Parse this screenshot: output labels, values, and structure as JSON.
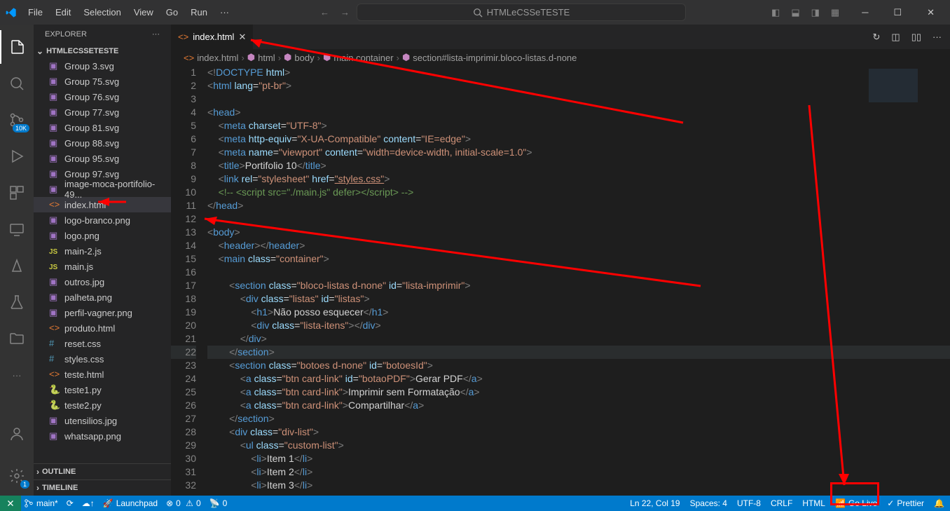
{
  "menu": {
    "file": "File",
    "edit": "Edit",
    "selection": "Selection",
    "view": "View",
    "go": "Go",
    "run": "Run"
  },
  "searchPlaceholder": "HTMLeCSSeTESTE",
  "explorer": {
    "title": "EXPLORER",
    "project": "HTMLECSSETESTE"
  },
  "files": [
    {
      "name": "Group 3.svg",
      "icon": "svg"
    },
    {
      "name": "Group 75.svg",
      "icon": "svg"
    },
    {
      "name": "Group 76.svg",
      "icon": "svg"
    },
    {
      "name": "Group 77.svg",
      "icon": "svg"
    },
    {
      "name": "Group 81.svg",
      "icon": "svg"
    },
    {
      "name": "Group 88.svg",
      "icon": "svg"
    },
    {
      "name": "Group 95.svg",
      "icon": "svg"
    },
    {
      "name": "Group 97.svg",
      "icon": "svg"
    },
    {
      "name": "image-moca-portifolio-49...",
      "icon": "img"
    },
    {
      "name": "index.html",
      "icon": "html",
      "selected": true
    },
    {
      "name": "logo-branco.png",
      "icon": "img"
    },
    {
      "name": "logo.png",
      "icon": "img"
    },
    {
      "name": "main-2.js",
      "icon": "js"
    },
    {
      "name": "main.js",
      "icon": "js"
    },
    {
      "name": "outros.jpg",
      "icon": "img"
    },
    {
      "name": "palheta.png",
      "icon": "img"
    },
    {
      "name": "perfil-vagner.png",
      "icon": "img"
    },
    {
      "name": "produto.html",
      "icon": "html"
    },
    {
      "name": "reset.css",
      "icon": "css"
    },
    {
      "name": "styles.css",
      "icon": "css"
    },
    {
      "name": "teste.html",
      "icon": "html"
    },
    {
      "name": "teste1.py",
      "icon": "py"
    },
    {
      "name": "teste2.py",
      "icon": "py"
    },
    {
      "name": "utensilios.jpg",
      "icon": "img"
    },
    {
      "name": "whatsapp.png",
      "icon": "img"
    }
  ],
  "outline": "OUTLINE",
  "timeline": "TIMELINE",
  "tab": {
    "name": "index.html"
  },
  "breadcrumb": [
    "index.html",
    "html",
    "body",
    "main.container",
    "section#lista-imprimir.bloco-listas.d-none"
  ],
  "scmBadge": "10K",
  "statusbar": {
    "branch": "main*",
    "launchpad": "Launchpad",
    "errors": "0",
    "warnings": "0",
    "port": "0",
    "pos": "Ln 22, Col 19",
    "spaces": "Spaces: 4",
    "encoding": "UTF-8",
    "eol": "CRLF",
    "lang": "HTML",
    "golive": "Go Live",
    "prettier": "Prettier"
  },
  "codeLines": [
    {
      "n": 1,
      "indent": 0,
      "html": "<span class='t-gray'>&lt;!</span><span class='t-blue'>DOCTYPE</span> <span class='t-lblue'>html</span><span class='t-gray'>&gt;</span>"
    },
    {
      "n": 2,
      "indent": 0,
      "html": "<span class='t-gray'>&lt;</span><span class='t-blue'>html</span> <span class='t-lblue'>lang</span>=<span class='t-str'>\"pt-br\"</span><span class='t-gray'>&gt;</span>"
    },
    {
      "n": 3,
      "indent": 0,
      "html": ""
    },
    {
      "n": 4,
      "indent": 0,
      "html": "<span class='t-gray'>&lt;</span><span class='t-blue'>head</span><span class='t-gray'>&gt;</span>"
    },
    {
      "n": 5,
      "indent": 1,
      "html": "<span class='t-gray'>&lt;</span><span class='t-blue'>meta</span> <span class='t-lblue'>charset</span>=<span class='t-str'>\"UTF-8\"</span><span class='t-gray'>&gt;</span>"
    },
    {
      "n": 6,
      "indent": 1,
      "html": "<span class='t-gray'>&lt;</span><span class='t-blue'>meta</span> <span class='t-lblue'>http-equiv</span>=<span class='t-str'>\"X-UA-Compatible\"</span> <span class='t-lblue'>content</span>=<span class='t-str'>\"IE=edge\"</span><span class='t-gray'>&gt;</span>"
    },
    {
      "n": 7,
      "indent": 1,
      "html": "<span class='t-gray'>&lt;</span><span class='t-blue'>meta</span> <span class='t-lblue'>name</span>=<span class='t-str'>\"viewport\"</span> <span class='t-lblue'>content</span>=<span class='t-str'>\"width=device-width, initial-scale=1.0\"</span><span class='t-gray'>&gt;</span>"
    },
    {
      "n": 8,
      "indent": 1,
      "html": "<span class='t-gray'>&lt;</span><span class='t-blue'>title</span><span class='t-gray'>&gt;</span>Portifolio 10<span class='t-gray'>&lt;/</span><span class='t-blue'>title</span><span class='t-gray'>&gt;</span>"
    },
    {
      "n": 9,
      "indent": 1,
      "html": "<span class='t-gray'>&lt;</span><span class='t-blue'>link</span> <span class='t-lblue'>rel</span>=<span class='t-str'>\"stylesheet\"</span> <span class='t-lblue'>href</span>=<span class='t-str' style='text-decoration:underline'>\"styles.css\"</span><span class='t-gray'>&gt;</span>"
    },
    {
      "n": 10,
      "indent": 1,
      "html": "<span class='t-comm'>&lt;!-- &lt;script src=\"./main.js\" defer&gt;&lt;/script&gt; --&gt;</span>"
    },
    {
      "n": 11,
      "indent": 0,
      "html": "<span class='t-gray'>&lt;/</span><span class='t-blue'>head</span><span class='t-gray'>&gt;</span>"
    },
    {
      "n": 12,
      "indent": 0,
      "html": ""
    },
    {
      "n": 13,
      "indent": 0,
      "html": "<span class='t-gray'>&lt;</span><span class='t-blue'>body</span><span class='t-gray'>&gt;</span>"
    },
    {
      "n": 14,
      "indent": 1,
      "html": "<span class='t-gray'>&lt;</span><span class='t-blue'>header</span><span class='t-gray'>&gt;&lt;/</span><span class='t-blue'>header</span><span class='t-gray'>&gt;</span>"
    },
    {
      "n": 15,
      "indent": 1,
      "html": "<span class='t-gray'>&lt;</span><span class='t-blue'>main</span> <span class='t-lblue'>class</span>=<span class='t-str'>\"container\"</span><span class='t-gray'>&gt;</span>"
    },
    {
      "n": 16,
      "indent": 1,
      "html": ""
    },
    {
      "n": 17,
      "indent": 2,
      "html": "<span class='t-gray'>&lt;</span><span class='t-blue'>section</span> <span class='t-lblue'>class</span>=<span class='t-str'>\"bloco-listas d-none\"</span> <span class='t-lblue'>id</span>=<span class='t-str'>\"lista-imprimir\"</span><span class='t-gray'>&gt;</span>"
    },
    {
      "n": 18,
      "indent": 3,
      "html": "<span class='t-gray'>&lt;</span><span class='t-blue'>div</span> <span class='t-lblue'>class</span>=<span class='t-str'>\"listas\"</span> <span class='t-lblue'>id</span>=<span class='t-str'>\"listas\"</span><span class='t-gray'>&gt;</span>"
    },
    {
      "n": 19,
      "indent": 4,
      "html": "<span class='t-gray'>&lt;</span><span class='t-blue'>h1</span><span class='t-gray'>&gt;</span>Não posso esquecer<span class='t-gray'>&lt;/</span><span class='t-blue'>h1</span><span class='t-gray'>&gt;</span>"
    },
    {
      "n": 20,
      "indent": 4,
      "html": "<span class='t-gray'>&lt;</span><span class='t-blue'>div</span> <span class='t-lblue'>class</span>=<span class='t-str'>\"lista-itens\"</span><span class='t-gray'>&gt;&lt;/</span><span class='t-blue'>div</span><span class='t-gray'>&gt;</span>"
    },
    {
      "n": 21,
      "indent": 3,
      "html": "<span class='t-gray'>&lt;/</span><span class='t-blue'>div</span><span class='t-gray'>&gt;</span>"
    },
    {
      "n": 22,
      "indent": 2,
      "html": "<span class='t-gray'>&lt;/</span><span class='t-blue'>section</span><span class='t-gray'>&gt;</span>",
      "current": true
    },
    {
      "n": 23,
      "indent": 2,
      "html": "<span class='t-gray'>&lt;</span><span class='t-blue'>section</span> <span class='t-lblue'>class</span>=<span class='t-str'>\"botoes d-none\"</span> <span class='t-lblue'>id</span>=<span class='t-str'>\"botoesId\"</span><span class='t-gray'>&gt;</span>"
    },
    {
      "n": 24,
      "indent": 3,
      "html": "<span class='t-gray'>&lt;</span><span class='t-blue'>a</span> <span class='t-lblue'>class</span>=<span class='t-str'>\"btn card-link\"</span> <span class='t-lblue'>id</span>=<span class='t-str'>\"botaoPDF\"</span><span class='t-gray'>&gt;</span>Gerar PDF<span class='t-gray'>&lt;/</span><span class='t-blue'>a</span><span class='t-gray'>&gt;</span>"
    },
    {
      "n": 25,
      "indent": 3,
      "html": "<span class='t-gray'>&lt;</span><span class='t-blue'>a</span> <span class='t-lblue'>class</span>=<span class='t-str'>\"btn card-link\"</span><span class='t-gray'>&gt;</span>Imprimir sem Formatação<span class='t-gray'>&lt;/</span><span class='t-blue'>a</span><span class='t-gray'>&gt;</span>"
    },
    {
      "n": 26,
      "indent": 3,
      "html": "<span class='t-gray'>&lt;</span><span class='t-blue'>a</span> <span class='t-lblue'>class</span>=<span class='t-str'>\"btn card-link\"</span><span class='t-gray'>&gt;</span>Compartilhar<span class='t-gray'>&lt;/</span><span class='t-blue'>a</span><span class='t-gray'>&gt;</span>"
    },
    {
      "n": 27,
      "indent": 2,
      "html": "<span class='t-gray'>&lt;/</span><span class='t-blue'>section</span><span class='t-gray'>&gt;</span>"
    },
    {
      "n": 28,
      "indent": 2,
      "html": "<span class='t-gray'>&lt;</span><span class='t-blue'>div</span> <span class='t-lblue'>class</span>=<span class='t-str'>\"div-list\"</span><span class='t-gray'>&gt;</span>"
    },
    {
      "n": 29,
      "indent": 3,
      "html": "<span class='t-gray'>&lt;</span><span class='t-blue'>ul</span> <span class='t-lblue'>class</span>=<span class='t-str'>\"custom-list\"</span><span class='t-gray'>&gt;</span>"
    },
    {
      "n": 30,
      "indent": 4,
      "html": "<span class='t-gray'>&lt;</span><span class='t-blue'>li</span><span class='t-gray'>&gt;</span>Item 1<span class='t-gray'>&lt;/</span><span class='t-blue'>li</span><span class='t-gray'>&gt;</span>"
    },
    {
      "n": 31,
      "indent": 4,
      "html": "<span class='t-gray'>&lt;</span><span class='t-blue'>li</span><span class='t-gray'>&gt;</span>Item 2<span class='t-gray'>&lt;/</span><span class='t-blue'>li</span><span class='t-gray'>&gt;</span>"
    },
    {
      "n": 32,
      "indent": 4,
      "html": "<span class='t-gray'>&lt;</span><span class='t-blue'>li</span><span class='t-gray'>&gt;</span>Item 3<span class='t-gray'>&lt;/</span><span class='t-blue'>li</span><span class='t-gray'>&gt;</span>"
    }
  ]
}
